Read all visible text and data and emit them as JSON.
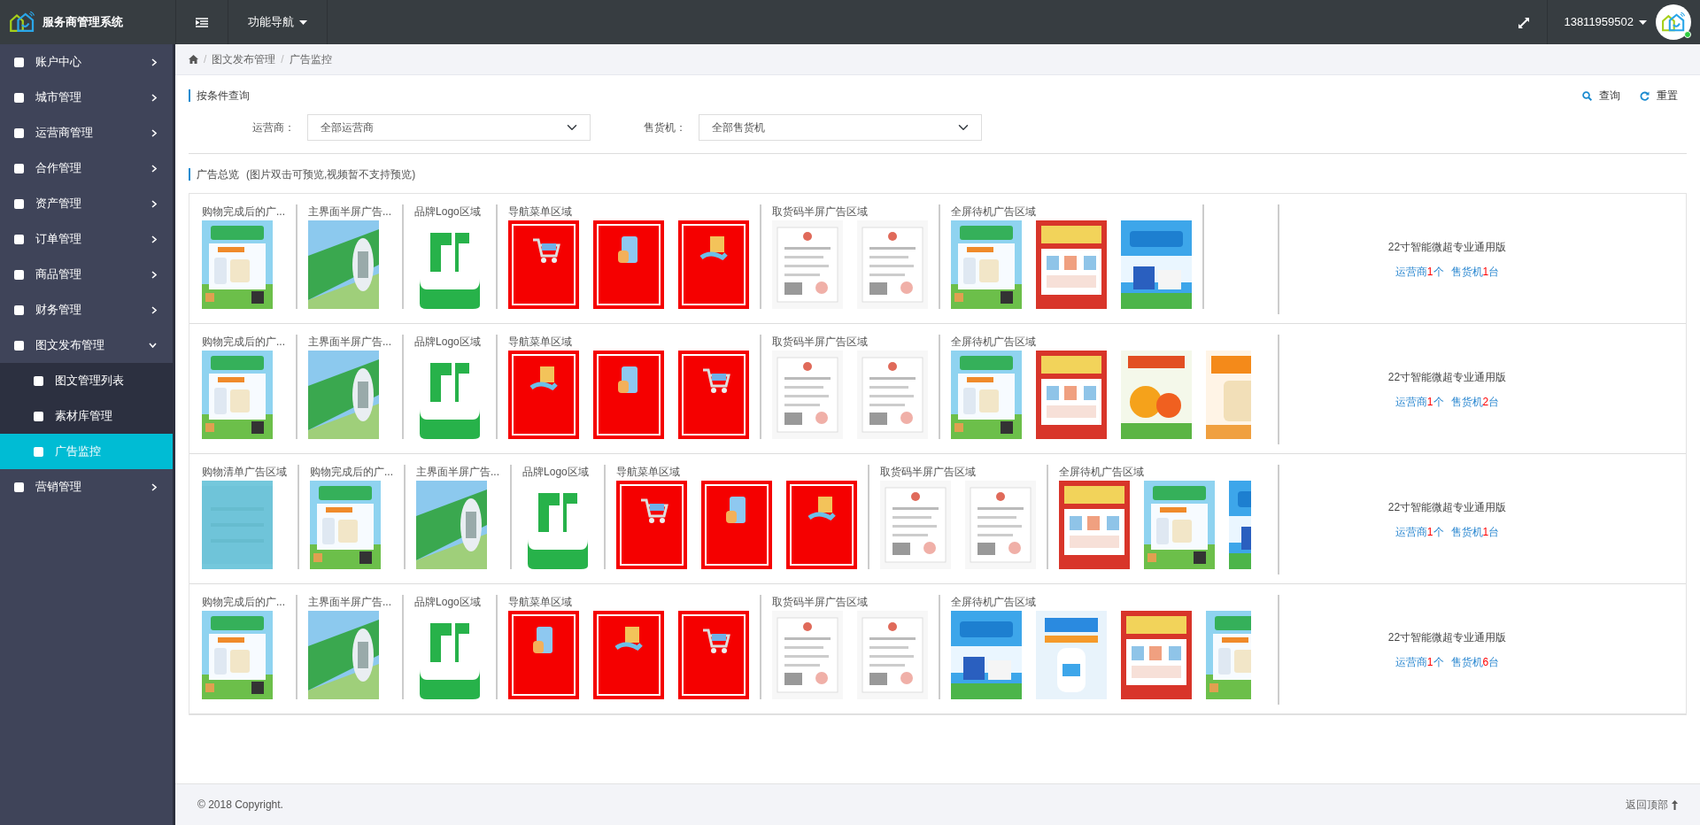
{
  "header": {
    "title": "服务商管理系统",
    "nav_menu": "功能导航",
    "user": "13811959502",
    "online": true
  },
  "sidebar": {
    "items": [
      {
        "label": "账户中心",
        "expanded": false
      },
      {
        "label": "城市管理",
        "expanded": false
      },
      {
        "label": "运营商管理",
        "expanded": false
      },
      {
        "label": "合作管理",
        "expanded": false
      },
      {
        "label": "资产管理",
        "expanded": false
      },
      {
        "label": "订单管理",
        "expanded": false
      },
      {
        "label": "商品管理",
        "expanded": false
      },
      {
        "label": "财务管理",
        "expanded": false
      },
      {
        "label": "图文发布管理",
        "expanded": true,
        "children": [
          {
            "label": "图文管理列表",
            "selected": false
          },
          {
            "label": "素材库管理",
            "selected": false
          },
          {
            "label": "广告监控",
            "selected": true
          }
        ]
      },
      {
        "label": "营销管理",
        "expanded": false
      }
    ]
  },
  "breadcrumb": {
    "separator": "/",
    "items": [
      "图文发布管理",
      "广告监控"
    ]
  },
  "filter": {
    "title": "按条件查询",
    "search_button": "查询",
    "reset_button": "重置",
    "fields": [
      {
        "label": "运营商：",
        "value": "全部运营商"
      },
      {
        "label": "售货机：",
        "value": "全部售货机"
      }
    ]
  },
  "overview": {
    "title": "广告总览",
    "note": "(图片双击可预览,视频暂不支持预览)",
    "rows": [
      {
        "groups": [
          {
            "label": "购物完成后的广...",
            "images": [
              {
                "kind": "coupon"
              }
            ]
          },
          {
            "label": "主界面半屏广告...",
            "images": [
              {
                "kind": "banner"
              }
            ]
          },
          {
            "label": "品牌Logo区域",
            "images": [
              {
                "kind": "logo"
              }
            ]
          },
          {
            "label": "导航菜单区域",
            "images": [
              {
                "kind": "cart"
              },
              {
                "kind": "help"
              },
              {
                "kind": "pickup"
              }
            ]
          },
          {
            "label": "取货码半屏广告区域",
            "images": [
              {
                "kind": "license"
              },
              {
                "kind": "license"
              }
            ]
          },
          {
            "label": "全屏待机广告区域",
            "images": [
              {
                "kind": "coupon"
              },
              {
                "kind": "poster-red"
              },
              {
                "kind": "poster-blue"
              }
            ]
          }
        ],
        "device": "22寸智能微超专业通用版",
        "operators": {
          "prefix": "运营商",
          "count": "1",
          "unit": "个"
        },
        "machines": {
          "prefix": "售货机",
          "count": "1",
          "unit": "台"
        }
      },
      {
        "groups": [
          {
            "label": "购物完成后的广...",
            "images": [
              {
                "kind": "coupon"
              }
            ]
          },
          {
            "label": "主界面半屏广告...",
            "images": [
              {
                "kind": "banner"
              }
            ]
          },
          {
            "label": "品牌Logo区域",
            "images": [
              {
                "kind": "logo"
              }
            ]
          },
          {
            "label": "导航菜单区域",
            "images": [
              {
                "kind": "pickup"
              },
              {
                "kind": "help"
              },
              {
                "kind": "cart"
              }
            ]
          },
          {
            "label": "取货码半屏广告区域",
            "images": [
              {
                "kind": "license"
              },
              {
                "kind": "license"
              }
            ]
          },
          {
            "label": "全屏待机广告区域",
            "images": [
              {
                "kind": "coupon"
              },
              {
                "kind": "poster-red"
              },
              {
                "kind": "fruit"
              },
              {
                "kind": "poster-orange"
              }
            ]
          }
        ],
        "device": "22寸智能微超专业通用版",
        "operators": {
          "prefix": "运营商",
          "count": "1",
          "unit": "个"
        },
        "machines": {
          "prefix": "售货机",
          "count": "2",
          "unit": "台"
        }
      },
      {
        "groups": [
          {
            "label": "购物清单广告区域",
            "images": [
              {
                "kind": "placeholder"
              }
            ]
          },
          {
            "label": "购物完成后的广...",
            "images": [
              {
                "kind": "coupon"
              }
            ]
          },
          {
            "label": "主界面半屏广告...",
            "images": [
              {
                "kind": "banner"
              }
            ]
          },
          {
            "label": "品牌Logo区域",
            "images": [
              {
                "kind": "logo"
              }
            ]
          },
          {
            "label": "导航菜单区域",
            "images": [
              {
                "kind": "cart"
              },
              {
                "kind": "help"
              },
              {
                "kind": "pickup"
              }
            ]
          },
          {
            "label": "取货码半屏广告区域",
            "images": [
              {
                "kind": "license"
              },
              {
                "kind": "license"
              }
            ]
          },
          {
            "label": "全屏待机广告区域",
            "images": [
              {
                "kind": "poster-red"
              },
              {
                "kind": "coupon"
              },
              {
                "kind": "poster-blue"
              }
            ]
          }
        ],
        "device": "22寸智能微超专业通用版",
        "operators": {
          "prefix": "运营商",
          "count": "1",
          "unit": "个"
        },
        "machines": {
          "prefix": "售货机",
          "count": "1",
          "unit": "台"
        }
      },
      {
        "groups": [
          {
            "label": "购物完成后的广...",
            "images": [
              {
                "kind": "coupon"
              }
            ]
          },
          {
            "label": "主界面半屏广告...",
            "images": [
              {
                "kind": "banner"
              }
            ]
          },
          {
            "label": "品牌Logo区域",
            "images": [
              {
                "kind": "logo"
              }
            ]
          },
          {
            "label": "导航菜单区域",
            "images": [
              {
                "kind": "help"
              },
              {
                "kind": "pickup"
              },
              {
                "kind": "cart"
              }
            ]
          },
          {
            "label": "取货码半屏广告区域",
            "images": [
              {
                "kind": "license"
              },
              {
                "kind": "license"
              }
            ]
          },
          {
            "label": "全屏待机广告区域",
            "images": [
              {
                "kind": "poster-blue"
              },
              {
                "kind": "milk"
              },
              {
                "kind": "poster-red"
              },
              {
                "kind": "coupon"
              }
            ]
          }
        ],
        "device": "22寸智能微超专业通用版",
        "operators": {
          "prefix": "运营商",
          "count": "1",
          "unit": "个"
        },
        "machines": {
          "prefix": "售货机",
          "count": "6",
          "unit": "台"
        }
      }
    ]
  },
  "footer": {
    "copyright": "© 2018 Copyright.",
    "back_to_top": "返回顶部"
  }
}
